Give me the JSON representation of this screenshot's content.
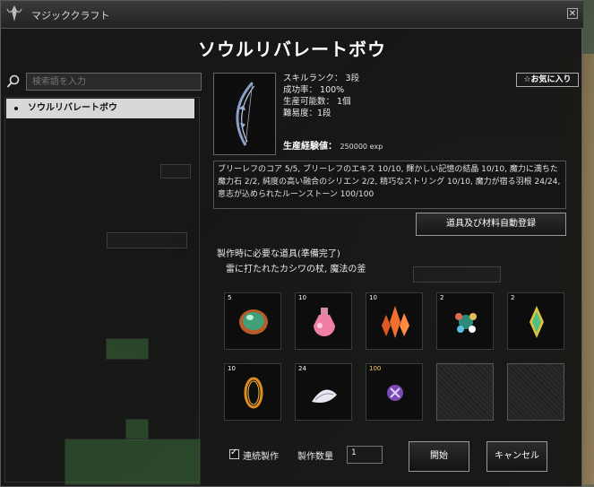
{
  "window": {
    "title": "マジッククラフト",
    "close_label": "✕",
    "heading": "ソウルリバレートボウ"
  },
  "search": {
    "placeholder": "検索語を入力"
  },
  "recipe_list": {
    "items": [
      {
        "label": "ソウルリバレートボウ",
        "selected": true
      }
    ]
  },
  "detail": {
    "stats": [
      "スキルランク： 3段",
      "成功率： 100%",
      "生産可能数： 1個",
      "難易度：1段"
    ],
    "exp_label": "生産経験値：",
    "exp_value": "250000 exp",
    "favorite_label": "☆お気に入り",
    "materials_text": "ブリーレフのコア 5/5, ブリーレフのエキス 10/10, 輝かしい記憶の結晶 10/10, 魔力に満ちた魔力石 2/2, 純度の高い融合のシリエン 2/2, 精巧なストリング 10/10, 魔力が宿る羽根 24/24, 意志が込められたルーンストーン 100/100",
    "auto_register_label": "道具及び材料自動登録",
    "tools_heading": "製作時に必要な道具(準備完了)",
    "tools_value": "雷に打たれたカシワの杖, 魔法の釜"
  },
  "slots": [
    {
      "qty": "5",
      "icon": "green-orb-icon"
    },
    {
      "qty": "10",
      "icon": "pink-potion-icon"
    },
    {
      "qty": "10",
      "icon": "orange-crystal-icon"
    },
    {
      "qty": "2",
      "icon": "rune-cluster-icon"
    },
    {
      "qty": "2",
      "icon": "green-crystal-icon"
    },
    {
      "qty": "10",
      "icon": "string-ring-icon"
    },
    {
      "qty": "24",
      "icon": "feather-icon"
    },
    {
      "qty": "100",
      "icon": "rune-stone-icon"
    },
    {
      "qty": "",
      "icon": "empty-slot"
    },
    {
      "qty": "",
      "icon": "empty-slot"
    }
  ],
  "footer": {
    "continuous_label": "連続製作",
    "quantity_label": "製作数量",
    "quantity_value": "1",
    "start_label": "開始",
    "cancel_label": "キャンセル"
  },
  "colors": {
    "qty_gold": "#ffd060",
    "selected_bg": "#d8d8d8"
  }
}
